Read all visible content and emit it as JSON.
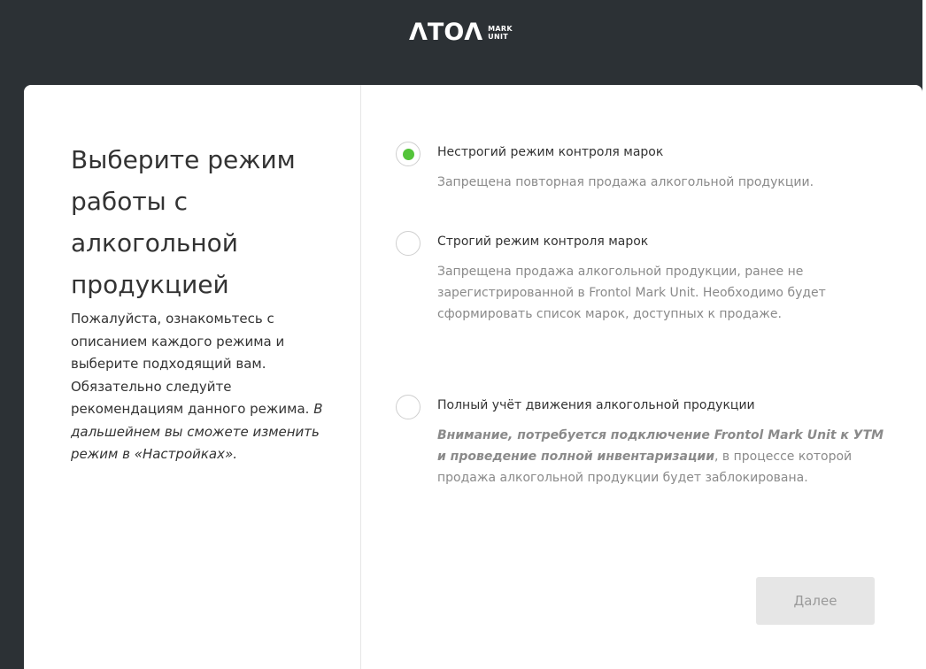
{
  "header": {
    "logo_mark": "ΛTOΛ",
    "logo_sub_1": "MARK",
    "logo_sub_2": "UNIT"
  },
  "left": {
    "title": "Выберите режим работы с алкогольной продукцией",
    "desc_main": "Пожалуйста, ознакомьтесь с описанием каждого режима и выберите подходящий вам. Обязательно следуйте рекомендациям данного режима.",
    "desc_italic": "В дальшейнем вы сможете изменить режим в «Настройках»."
  },
  "options": [
    {
      "title": "Нестрогий режим контроля марок",
      "description": "Запрещена повторная продажа алкогольной продукции.",
      "checked": true
    },
    {
      "title": "Строгий режим контроля марок",
      "description": "Запрещена продажа алкогольной продукции, ранее не зарегистрированной в Frontol Mark Unit. Необходимо будет сформировать список марок, доступных к продаже.",
      "checked": false
    },
    {
      "title": "Полный учёт движения алкогольной продукции",
      "description_emphasis": "Внимание, потребуется подключение Frontol Mark Unit к УТМ и проведение полной инвентаризации",
      "description_rest": ", в процессе которой продажа алкогольной продукции будет заблокирована.",
      "checked": false
    }
  ],
  "actions": {
    "next_label": "Далее"
  },
  "colors": {
    "header_bg": "#2c3135",
    "radio_selected": "#54c43a",
    "button_disabled_bg": "#e6e6e6"
  }
}
